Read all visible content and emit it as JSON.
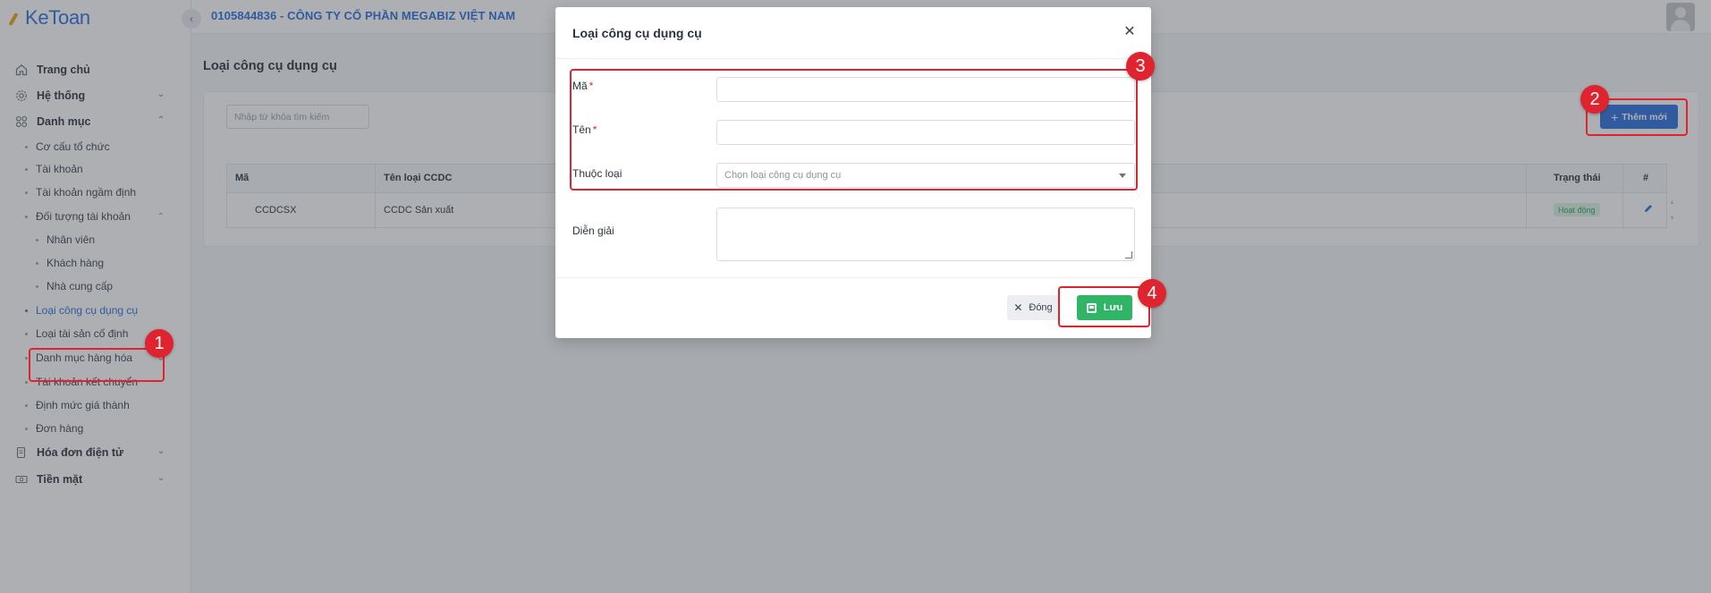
{
  "app": {
    "logo_text": "KeToan",
    "company": "0105844836 - CÔNG TY CỔ PHẦN MEGABIZ VIỆT NAM"
  },
  "sidebar": {
    "items": [
      {
        "label": "Trang chủ",
        "icon": "home-icon"
      },
      {
        "label": "Hệ thống",
        "icon": "gear-icon"
      },
      {
        "label": "Danh mục",
        "icon": "grid-icon"
      }
    ],
    "sub_items": [
      "Cơ cấu tổ chức",
      "Tài khoản",
      "Tài khoản ngầm định",
      "Đối tượng tài khoản"
    ],
    "sub_sub_items": [
      "Nhân viên",
      "Khách hàng",
      "Nhà cung cấp"
    ],
    "sub_items_2": [
      "Loại công cụ dụng cụ",
      "Loại tài sản cố định",
      "Danh mục hàng hóa",
      "Tài khoản kết chuyển",
      "Định mức giá thành",
      "Đơn hàng"
    ],
    "bottom_items": [
      {
        "label": "Hóa đơn điện tử",
        "icon": "invoice-icon"
      },
      {
        "label": "Tiền mặt",
        "icon": "cash-icon"
      }
    ]
  },
  "main": {
    "page_title": "Loại công cụ dụng cụ",
    "search_placeholder": "Nhập từ khóa tìm kiếm",
    "add_button": "Thêm mới",
    "table": {
      "headers": [
        "Mã",
        "Tên loại CCDC",
        "Trạng thái",
        "#"
      ],
      "rows": [
        {
          "code": "CCDCSX",
          "name": "CCDC Sản xuất",
          "status": "Hoạt động"
        }
      ]
    }
  },
  "modal": {
    "title": "Loại công cụ dụng cụ",
    "fields": {
      "code_label": "Mã",
      "name_label": "Tên",
      "type_label": "Thuộc loại",
      "type_placeholder": "Chọn loại công cụ dụng cụ",
      "desc_label": "Diễn giải"
    },
    "required_mark": "*",
    "close_button": "Đóng",
    "save_button": "Lưu"
  },
  "annotations": [
    "1",
    "2",
    "3",
    "4"
  ],
  "colors": {
    "accent": "#2a6ee0",
    "annotation": "#e0242f",
    "success": "#2fb565"
  }
}
